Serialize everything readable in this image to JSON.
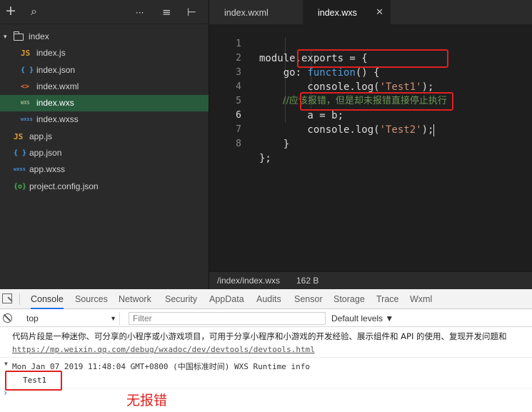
{
  "sidebar": {
    "toolbar": {
      "add_icon": "+",
      "search_icon": "⌕",
      "more_icon": "···",
      "sort_icon": "≡",
      "collapse_icon": "⊢"
    },
    "folder": {
      "name": "index",
      "caret": "▾"
    },
    "files": [
      {
        "icon": "JS",
        "color": "#e0a030",
        "name": "index.js"
      },
      {
        "icon": "{ }",
        "color": "#4aa0e0",
        "name": "index.json"
      },
      {
        "icon": "<>",
        "color": "#e07030",
        "name": "index.wxml"
      },
      {
        "icon": "WXS",
        "color": "#9ab88a",
        "name": "index.wxs"
      },
      {
        "icon": "wxss",
        "color": "#4a90d9",
        "name": "index.wxss"
      }
    ],
    "root_files": [
      {
        "icon": "JS",
        "color": "#e0a030",
        "name": "app.js"
      },
      {
        "icon": "{ }",
        "color": "#4aa0e0",
        "name": "app.json"
      },
      {
        "icon": "wxss",
        "color": "#4a90d9",
        "name": "app.wxss"
      },
      {
        "icon": "{o}",
        "color": "#4caf50",
        "name": "project.config.json"
      }
    ]
  },
  "editor": {
    "tabs": [
      {
        "label": "index.wxml"
      },
      {
        "label": "index.wxs",
        "close": "✕"
      }
    ],
    "lines": [
      {
        "n": "1",
        "t": "module.exports = {"
      },
      {
        "n": "2",
        "pre": "    go: ",
        "kw": "function",
        "post": "() {"
      },
      {
        "n": "3",
        "pre": "        console.log(",
        "str": "'Test1'",
        "post": ");"
      },
      {
        "n": "4",
        "comment": "        //应该报错，但是却未报错直接停止执行"
      },
      {
        "n": "5",
        "t": "        a = b;"
      },
      {
        "n": "6",
        "pre": "        console.log(",
        "str": "'Test2'",
        "post": ");"
      },
      {
        "n": "7",
        "t": "    }"
      },
      {
        "n": "8",
        "t": "};"
      }
    ],
    "status": {
      "path": "/index/index.wxs",
      "size": "162 B"
    }
  },
  "devtools": {
    "tabs": [
      "Console",
      "Sources",
      "Network",
      "Security",
      "AppData",
      "Audits",
      "Sensor",
      "Storage",
      "Trace",
      "Wxml"
    ],
    "context": "top",
    "context_arrow": "▼",
    "filter_placeholder": "Filter",
    "levels": "Default levels ▼",
    "messages": {
      "intro": "代码片段是一种迷你、可分享的小程序或小游戏项目，可用于分享小程序和小游戏的开发经验、展示组件和 API 的使用、复现开发问题和",
      "link": "https://mp.weixin.qq.com/debug/wxadoc/dev/devtools/devtools.html",
      "group": "Mon Jan 07 2019 11:48:04 GMT+0800 (中国标准时间) WXS Runtime info",
      "group_caret": "▼",
      "log": "Test1",
      "prompt": "›"
    },
    "annotation": "无报错"
  },
  "colors": {
    "accent_red": "#e02020",
    "active_tree": "#285a3c",
    "editor_bg": "#1e1e1e"
  }
}
